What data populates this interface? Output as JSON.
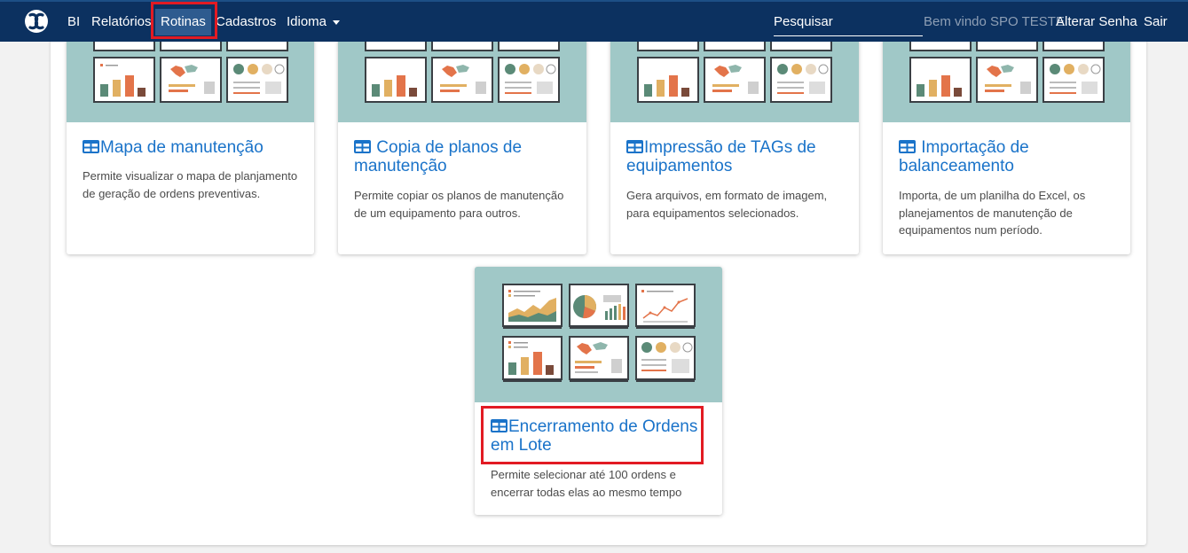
{
  "nav": {
    "items": [
      {
        "label": "BI"
      },
      {
        "label": "Relatórios"
      },
      {
        "label": "Rotinas"
      },
      {
        "label": "Cadastros"
      },
      {
        "label": "Idioma"
      }
    ],
    "search_placeholder": "Pesquisar",
    "welcome": "Bem vindo SPO TESTE",
    "change_password": "Alterar Senha",
    "logout": "Sair"
  },
  "cards": [
    {
      "title": "Mapa de manutenção",
      "description": "Permite visualizar o mapa de planjamento de geração de ordens preventivas."
    },
    {
      "title": "Copia de planos de manutenção",
      "description": "Permite copiar os planos de manutenção de um equipamento para outros."
    },
    {
      "title": "Impressão de TAGs de equipamentos",
      "description": "Gera arquivos, em formato de imagem, para equipamentos selecionados."
    },
    {
      "title": "Importação de balanceamento",
      "description": "Importa, de um planilha do Excel, os planejamentos de manutenção de equipamentos num período."
    },
    {
      "title": "Encerramento de Ordens em Lote",
      "description": "Permite selecionar até 100 ordens e encerrar todas elas ao mesmo tempo"
    }
  ],
  "colors": {
    "navbar": "#0c3160",
    "link": "#1a73c9",
    "card_image_bg": "#a0c8c7",
    "highlight": "#e21b23"
  },
  "icons": {
    "logo": "app-logo-icon",
    "card_title": "table-grid-icon"
  }
}
